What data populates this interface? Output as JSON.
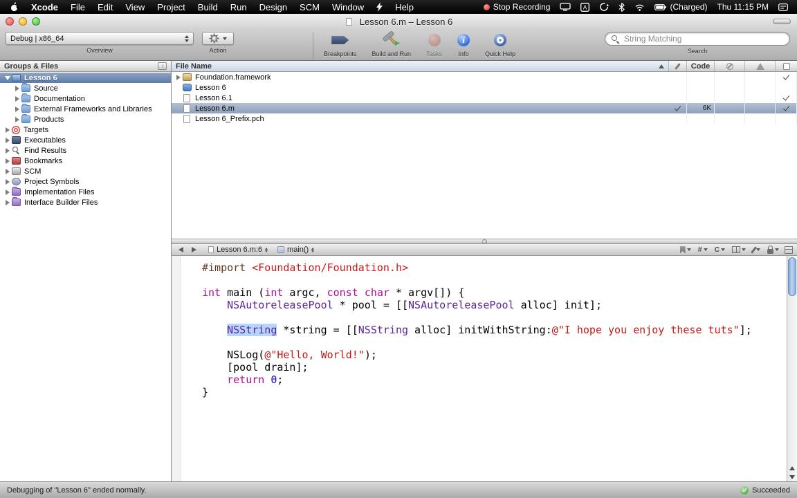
{
  "menu_bar": {
    "items": [
      {
        "icon": "apple-logo"
      },
      {
        "label": "Xcode",
        "bold": true
      },
      {
        "label": "File"
      },
      {
        "label": "Edit"
      },
      {
        "label": "View"
      },
      {
        "label": "Project"
      },
      {
        "label": "Build"
      },
      {
        "label": "Run"
      },
      {
        "label": "Design"
      },
      {
        "label": "SCM"
      },
      {
        "label": "Window"
      },
      {
        "icon": "lightning"
      },
      {
        "label": "Help"
      }
    ],
    "status": {
      "stop_recording": "Stop Recording",
      "icons": [
        "display",
        "input-menu",
        "time-machine",
        "bluetooth",
        "airport"
      ],
      "battery_icon": "battery",
      "battery_label": "(Charged)",
      "clock": "Thu 11:15 PM",
      "trailing_icon": "user-switch"
    }
  },
  "window": {
    "title": "Lesson 6.m – Lesson 6"
  },
  "toolbar": {
    "overview": {
      "value": "Debug | x86_64",
      "label": "Overview"
    },
    "action": {
      "label": "Action",
      "icon": "gear"
    },
    "buttons": [
      {
        "label": "Breakpoints",
        "icon": "breakpoints-badge",
        "disabled": false
      },
      {
        "label": "Build and Run",
        "icon": "hammer",
        "disabled": false
      },
      {
        "label": "Tasks",
        "icon": "stop-badge",
        "disabled": true
      },
      {
        "label": "Info",
        "icon": "info-badge",
        "disabled": false
      },
      {
        "label": "Quick Help",
        "icon": "quickhelp-badge",
        "disabled": false
      }
    ],
    "search": {
      "value": "String Matching",
      "label": "Search",
      "icon": "magnifier"
    }
  },
  "sidebar": {
    "header": "Groups & Files",
    "items": [
      {
        "label": "Lesson 6",
        "level": 0,
        "icon": "project",
        "disclosure": "expanded",
        "selected": true
      },
      {
        "label": "Source",
        "level": 1,
        "icon": "folder",
        "disclosure": "collapsed",
        "selected": false
      },
      {
        "label": "Documentation",
        "level": 1,
        "icon": "folder",
        "disclosure": "collapsed",
        "selected": false
      },
      {
        "label": "External Frameworks and Libraries",
        "level": 1,
        "icon": "folder",
        "disclosure": "collapsed",
        "selected": false
      },
      {
        "label": "Products",
        "level": 1,
        "icon": "folder",
        "disclosure": "collapsed",
        "selected": false
      },
      {
        "label": "Targets",
        "level": 0,
        "icon": "target",
        "disclosure": "collapsed",
        "selected": false
      },
      {
        "label": "Executables",
        "level": 0,
        "icon": "executable",
        "disclosure": "collapsed",
        "selected": false
      },
      {
        "label": "Find Results",
        "level": 0,
        "icon": "find",
        "disclosure": "collapsed",
        "selected": false
      },
      {
        "label": "Bookmarks",
        "level": 0,
        "icon": "book",
        "disclosure": "collapsed",
        "selected": false
      },
      {
        "label": "SCM",
        "level": 0,
        "icon": "scm",
        "disclosure": "collapsed",
        "selected": false
      },
      {
        "label": "Project Symbols",
        "level": 0,
        "icon": "symbols",
        "disclosure": "collapsed",
        "selected": false
      },
      {
        "label": "Implementation Files",
        "level": 0,
        "icon": "smart-folder",
        "disclosure": "collapsed",
        "selected": false
      },
      {
        "label": "Interface Builder Files",
        "level": 0,
        "icon": "smart-folder",
        "disclosure": "collapsed",
        "selected": false
      }
    ]
  },
  "file_list": {
    "name_column": "File Name",
    "sort": "ascending",
    "detail_columns": [
      {
        "icon": "build-status"
      },
      {
        "label": "Code"
      },
      {
        "icon": "errors"
      },
      {
        "icon": "warnings"
      },
      {
        "icon": "target-membership"
      }
    ],
    "rows": [
      {
        "name": "Foundation.framework",
        "icon": "framework",
        "disclosure": true,
        "selected": false,
        "build_check": false,
        "code_size": "",
        "target_member": true
      },
      {
        "name": "Lesson 6",
        "icon": "app",
        "disclosure": false,
        "selected": false,
        "build_check": false,
        "code_size": "",
        "target_member": false
      },
      {
        "name": "Lesson 6.1",
        "icon": "doc",
        "disclosure": false,
        "selected": false,
        "build_check": false,
        "code_size": "",
        "target_member": true
      },
      {
        "name": "Lesson 6.m",
        "icon": "doc",
        "disclosure": false,
        "selected": true,
        "build_check": true,
        "code_size": "6K",
        "target_member": true
      },
      {
        "name": "Lesson 6_Prefix.pch",
        "icon": "doc",
        "disclosure": false,
        "selected": false,
        "build_check": false,
        "code_size": "",
        "target_member": false
      }
    ]
  },
  "editor": {
    "nav": {
      "file_popup": "Lesson 6.m:6",
      "symbol_popup": "main()",
      "right_icons": [
        "bookmark",
        "hash",
        "class-browser",
        "counterpart",
        "pencil",
        "lock"
      ]
    },
    "lines": [
      [
        [
          "#import ",
          "pp"
        ],
        [
          "<Foundation/Foundation.h>",
          "str"
        ]
      ],
      [],
      [
        [
          "int",
          "kw"
        ],
        [
          " main (",
          "pl"
        ],
        [
          "int",
          "kw"
        ],
        [
          " argc, ",
          "pl"
        ],
        [
          "const",
          "kw"
        ],
        [
          " ",
          "pl"
        ],
        [
          "char",
          "kw"
        ],
        [
          " * argv[]) {",
          "pl"
        ]
      ],
      [
        [
          "    ",
          "pl"
        ],
        [
          "NSAutoreleasePool",
          "type"
        ],
        [
          " * pool = [[",
          "pl"
        ],
        [
          "NSAutoreleasePool",
          "type"
        ],
        [
          " alloc] init];",
          "pl"
        ]
      ],
      [],
      [
        [
          "    ",
          "pl"
        ],
        [
          "NSString",
          "type sel"
        ],
        [
          " *string = [[",
          "pl"
        ],
        [
          "NSString",
          "type"
        ],
        [
          " alloc] initWithString:",
          "pl"
        ],
        [
          "@\"I hope you enjoy these tuts\"",
          "str"
        ],
        [
          "];",
          "pl"
        ]
      ],
      [],
      [
        [
          "    NSLog(",
          "pl"
        ],
        [
          "@\"Hello, World!\"",
          "str"
        ],
        [
          ");",
          "pl"
        ]
      ],
      [
        [
          "    [pool drain];",
          "pl"
        ]
      ],
      [
        [
          "    ",
          "pl"
        ],
        [
          "return",
          "kw"
        ],
        [
          " ",
          "pl"
        ],
        [
          "0",
          "num"
        ],
        [
          ";",
          "pl"
        ]
      ],
      [
        [
          "}",
          "pl"
        ]
      ]
    ]
  },
  "status_bar": {
    "message": "Debugging of \"Lesson 6\" ended normally.",
    "result": "Succeeded"
  },
  "colors": {
    "selection_highlight": "#b5d5fc",
    "keyword": "#aa0d91",
    "string": "#c41a16",
    "preprocessor": "#643820",
    "class_name": "#5c2699",
    "number": "#1c00cf",
    "success_green": "#38a041",
    "sidebar_selection": "#5c7ca8"
  }
}
